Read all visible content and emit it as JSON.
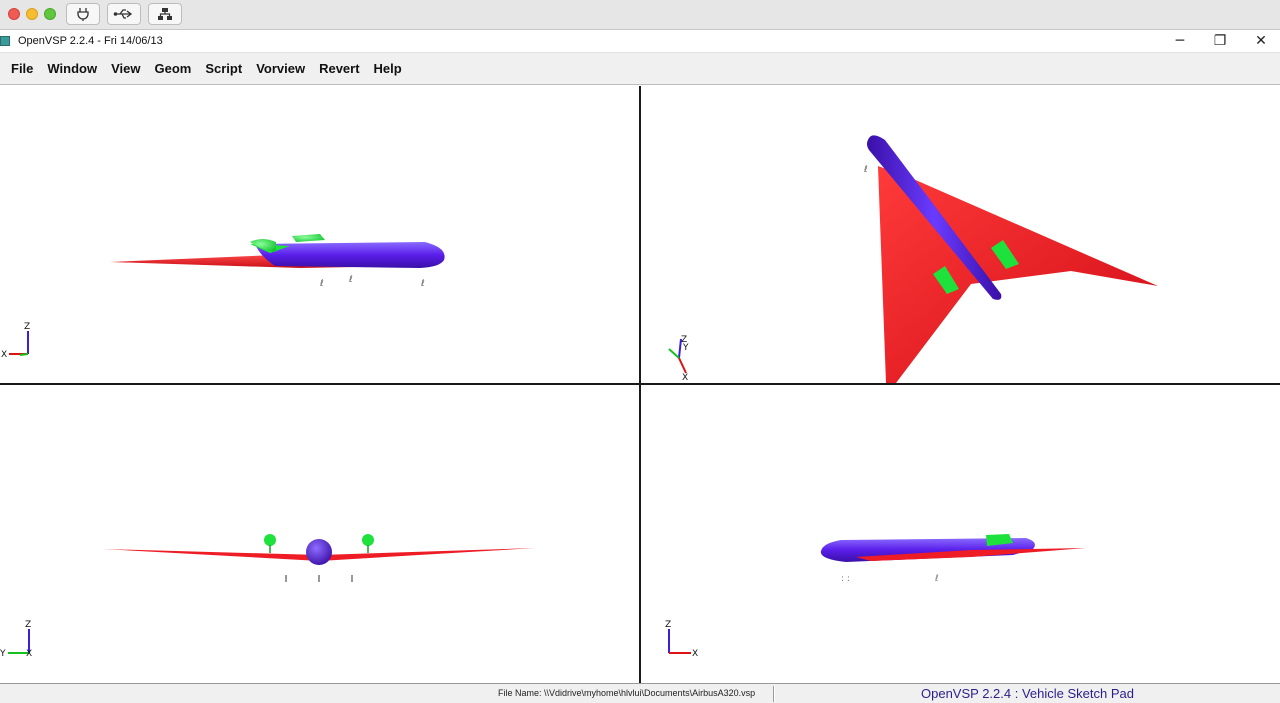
{
  "window": {
    "title": "OpenVSP 2.2.4 - Fri 14/06/13",
    "minimize_glyph": "─",
    "restore_glyph": "❐",
    "close_glyph": "✕"
  },
  "menu": {
    "items": [
      "File",
      "Window",
      "View",
      "Geom",
      "Script",
      "Vorview",
      "Revert",
      "Help"
    ]
  },
  "viewports": {
    "top_left": {
      "axes": [
        "Z",
        "X"
      ]
    },
    "top_right": {
      "axes": [
        "Z",
        "Y",
        "X"
      ]
    },
    "bottom_left": {
      "axes": [
        "Z",
        "Y",
        "X"
      ]
    },
    "bottom_right": {
      "axes": [
        "Z",
        "X"
      ]
    }
  },
  "status": {
    "file_name": "File Name: \\\\Vdidrive\\myhome\\hlvlui\\Documents\\AirbusA320.vsp",
    "app_name": "OpenVSP 2.2.4 : Vehicle Sketch Pad"
  },
  "colors": {
    "wing": "#ee1c25",
    "fuselage": "#5a1eea",
    "engine": "#1ee23c",
    "axis_x": "#dd1111",
    "axis_y": "#12c21a",
    "axis_z": "#3a1fe0"
  }
}
